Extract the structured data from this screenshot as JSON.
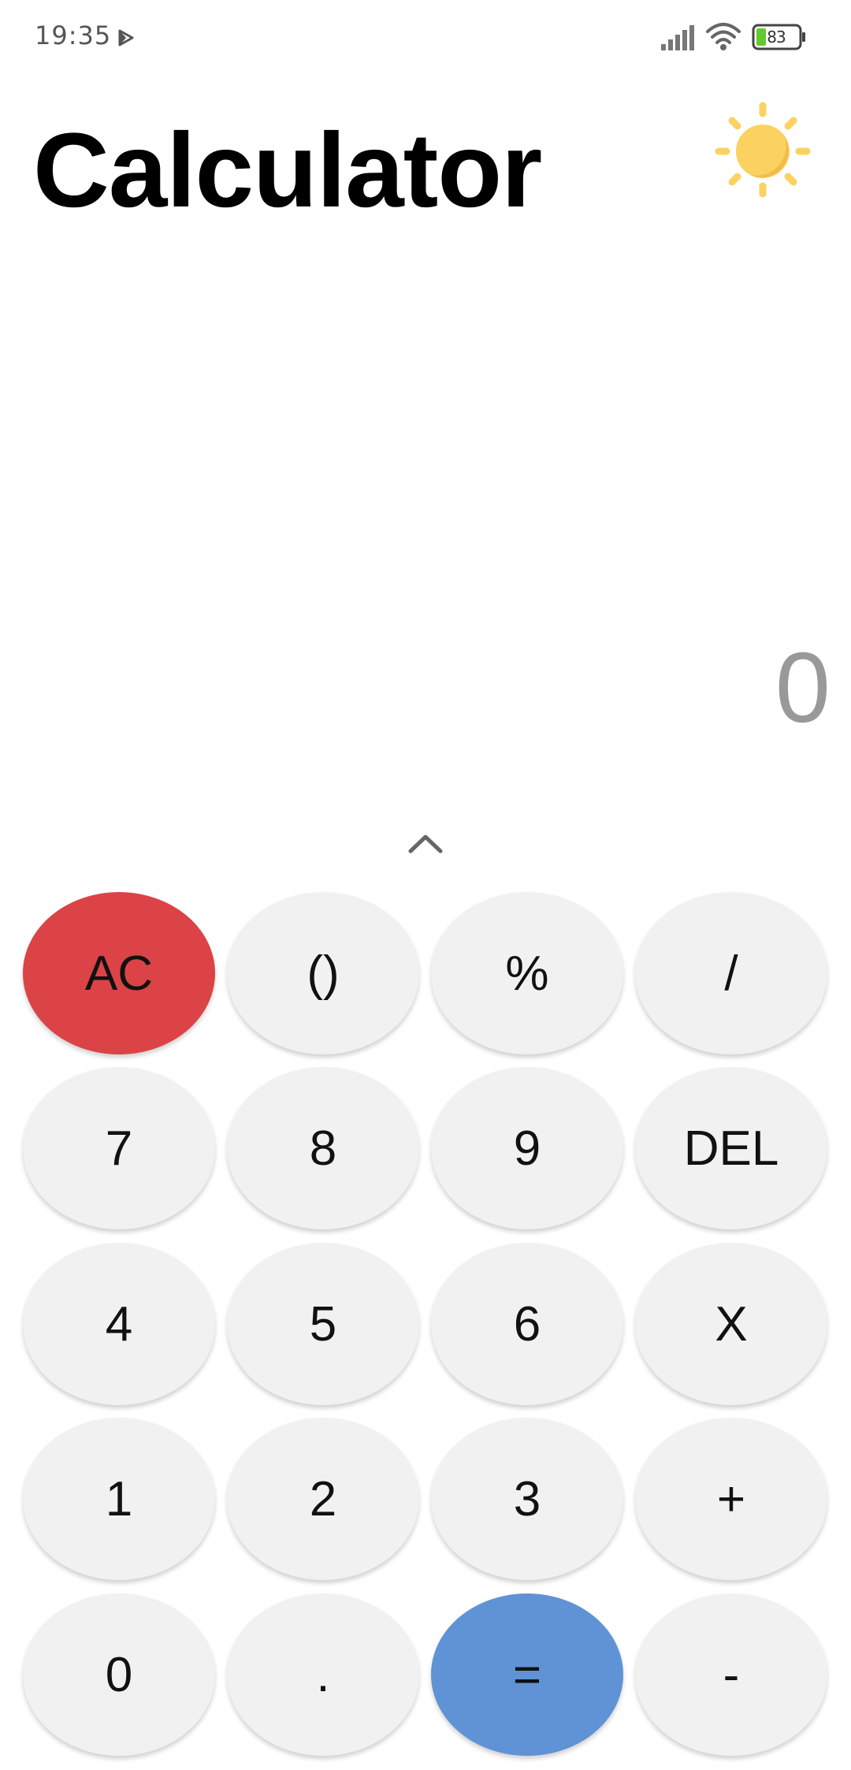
{
  "status_bar": {
    "time": "19:35",
    "battery": "83",
    "play_icon": "play-store-icon",
    "signal_icon": "signal-icon",
    "wifi_icon": "wifi-icon",
    "battery_icon": "battery-icon"
  },
  "header": {
    "title": "Calculator",
    "theme_icon": "sun-icon"
  },
  "display": {
    "value": "0",
    "expand_icon": "chevron-up-icon"
  },
  "keypad": {
    "rows": [
      [
        "AC",
        "()",
        "%",
        "/"
      ],
      [
        "7",
        "8",
        "9",
        "DEL"
      ],
      [
        "4",
        "5",
        "6",
        "X"
      ],
      [
        "1",
        "2",
        "3",
        "+"
      ],
      [
        "0",
        ".",
        "=",
        "-"
      ]
    ]
  },
  "colors": {
    "clear_key": "#db4346",
    "equals_key": "#5f93d5",
    "key_background": "#f1f1f1",
    "sun": "#fbd262"
  }
}
